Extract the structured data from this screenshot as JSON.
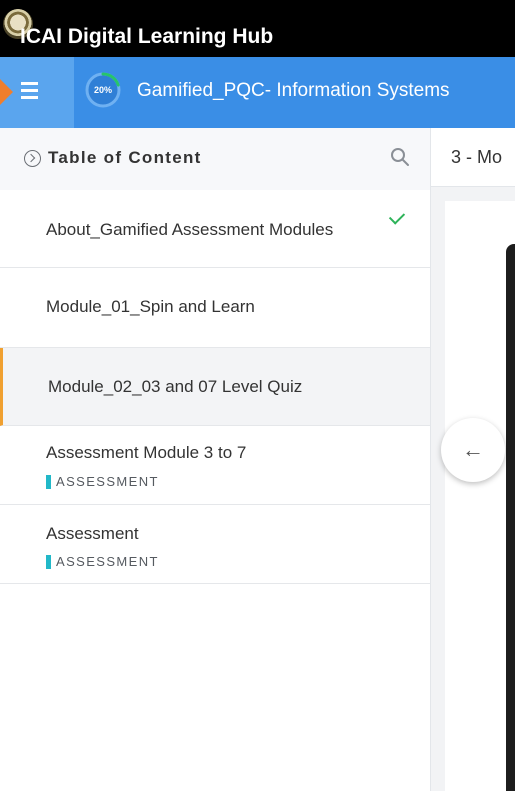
{
  "brand": {
    "title": "ICAI Digital Learning Hub"
  },
  "header": {
    "progress_label": "20%",
    "progress_value": 0.2,
    "course_title": "Gamified_PQC- Information Systems",
    "accent_color": "#3a8ee6",
    "progress_color": "#27c46b"
  },
  "toc": {
    "title": "Table of Content",
    "items": [
      {
        "label": "About_Gamified Assessment Modules",
        "completed": true
      },
      {
        "label": "Module_01_Spin and Learn"
      },
      {
        "label": "Module_02_03 and 07 Level Quiz",
        "active": true
      },
      {
        "label": "Assessment Module 3 to 7",
        "tag": "ASSESSMENT"
      },
      {
        "label": "Assessment",
        "tag": "ASSESSMENT"
      }
    ]
  },
  "content": {
    "tab_label": "3 - Mo",
    "back_arrow": "←"
  }
}
